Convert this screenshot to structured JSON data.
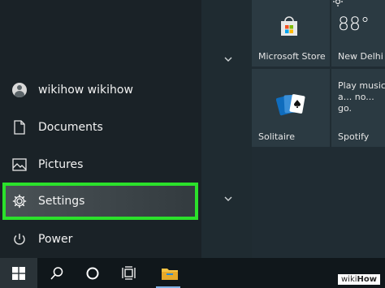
{
  "start_menu": {
    "items": [
      {
        "label": "wikihow wikihow",
        "icon": "user-avatar-icon"
      },
      {
        "label": "Documents",
        "icon": "document-icon"
      },
      {
        "label": "Pictures",
        "icon": "pictures-icon"
      },
      {
        "label": "Settings",
        "icon": "gear-icon",
        "highlighted": true
      },
      {
        "label": "Power",
        "icon": "power-icon"
      }
    ]
  },
  "tiles": {
    "store": {
      "label": "Microsoft Store",
      "icon": "store-bag-icon"
    },
    "weather": {
      "temp": "88°",
      "city": "New Delhi",
      "icon": "sun-icon"
    },
    "solitaire": {
      "label": "Solitaire",
      "icon": "cards-icon"
    },
    "spotify": {
      "label": "Spotify",
      "text": "Play music a... no... go."
    }
  },
  "taskbar": {
    "items": [
      "windows-start-icon",
      "search-icon",
      "cortana-icon",
      "task-view-icon",
      "file-explorer-icon"
    ]
  },
  "colors": {
    "highlight": "#2be12b",
    "menu_bg": "#1a2227",
    "tile_bg": "#2b3a42",
    "taskbar_bg": "#10171b"
  },
  "watermark": {
    "prefix": "wiki",
    "suffix": "How"
  }
}
